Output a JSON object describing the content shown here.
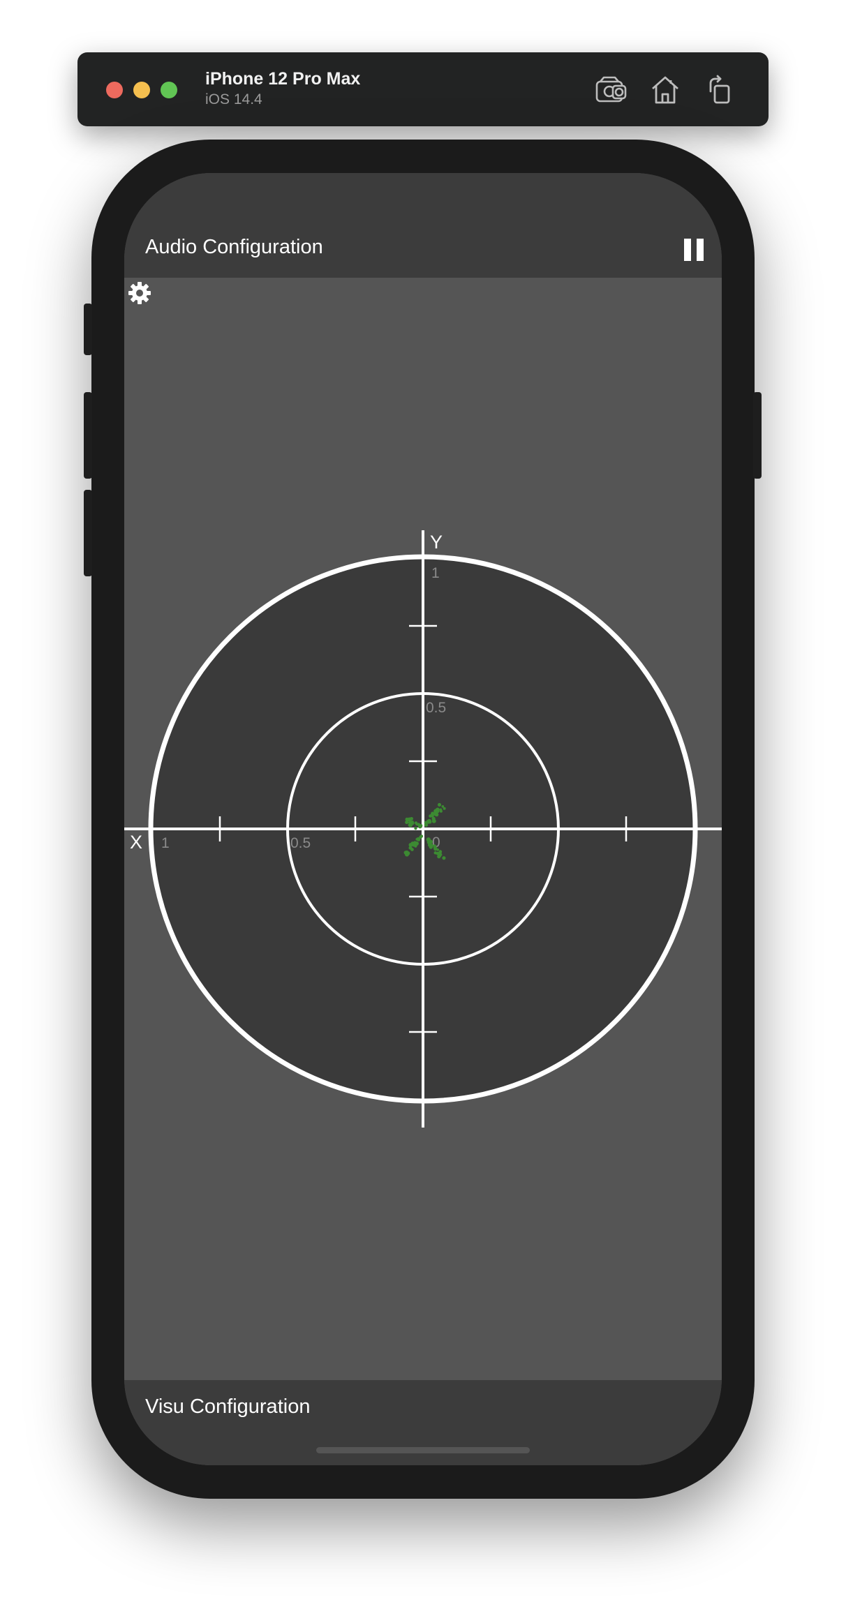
{
  "simulator": {
    "device_name": "iPhone 12 Pro Max",
    "os_version": "iOS 14.4"
  },
  "app": {
    "top_title": "Audio Configuration",
    "bottom_title": "Visu Configuration"
  },
  "scope": {
    "x_axis_label": "X",
    "y_axis_label": "Y",
    "y_tick_outer": "1",
    "y_tick_inner": "0.5",
    "x_tick_outer": "1",
    "x_tick_inner": "0.5",
    "origin_label": "0",
    "dot_color": "#3c8a32"
  }
}
